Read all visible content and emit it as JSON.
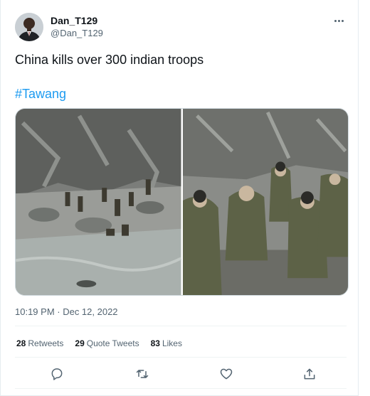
{
  "tweet": {
    "author": {
      "display_name": "Dan_T129",
      "handle": "@Dan_T129",
      "avatar_icon": "user-avatar"
    },
    "text": "China kills over 300 indian troops",
    "hashtag": "#Tawang",
    "media": [
      {
        "kind": "photo",
        "icon": "image"
      },
      {
        "kind": "photo",
        "icon": "image"
      }
    ],
    "timestamp": "10:19 PM · Dec 12, 2022",
    "stats": [
      {
        "count": "28",
        "label": "Retweets"
      },
      {
        "count": "29",
        "label": "Quote Tweets"
      },
      {
        "count": "83",
        "label": "Likes"
      }
    ],
    "actions": [
      {
        "icon": "reply-icon"
      },
      {
        "icon": "retweet-icon"
      },
      {
        "icon": "like-icon"
      },
      {
        "icon": "share-icon"
      }
    ],
    "colors": {
      "text_primary": "#0f1419",
      "text_secondary": "#536471",
      "link": "#1d9bf0",
      "divider": "#eff3f4"
    }
  }
}
